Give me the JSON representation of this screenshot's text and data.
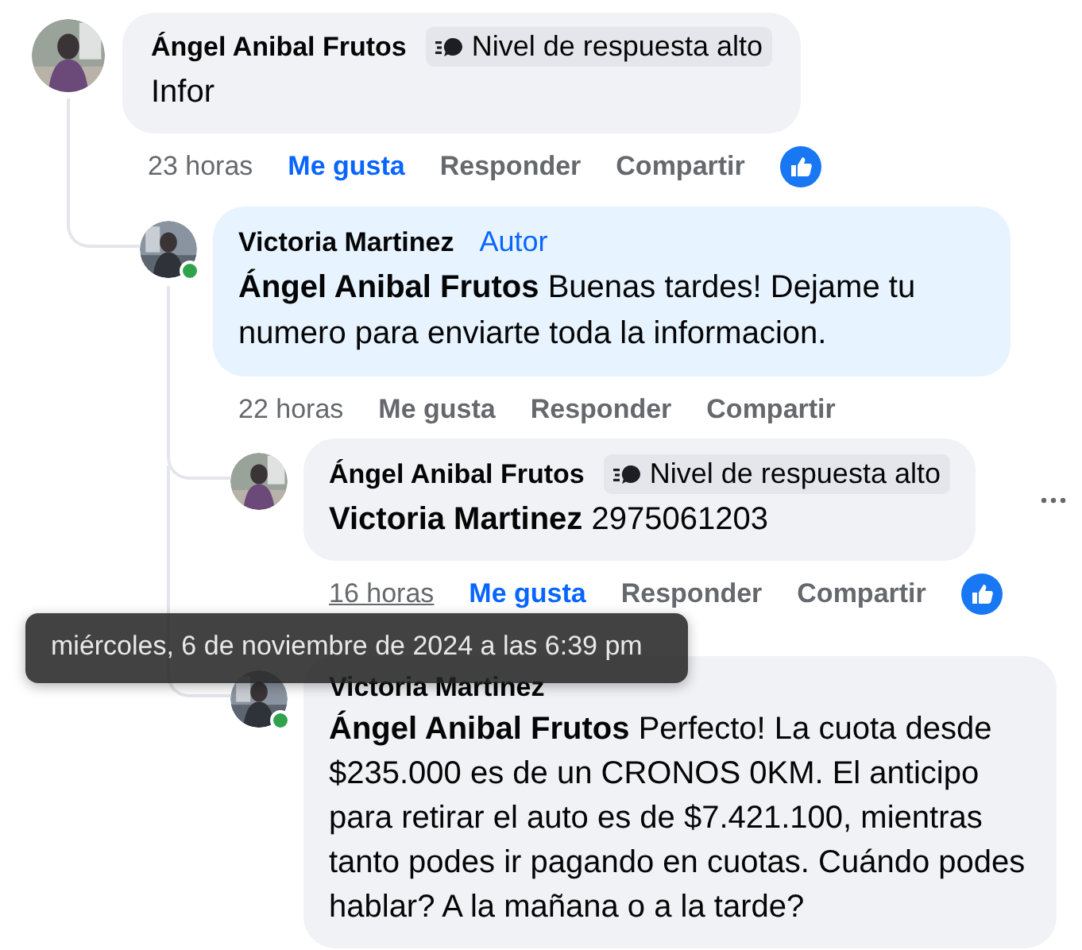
{
  "comments": [
    {
      "author": "Ángel Anibal Frutos",
      "badge": {
        "kind": "responder",
        "text": "Nivel de respuesta alto"
      },
      "text": "Infor",
      "time": "23 horas",
      "time_hovered": false,
      "like_label": "Me gusta",
      "liked": true,
      "reply_label": "Responder",
      "share_label": "Compartir",
      "like_reaction": true,
      "children": [
        {
          "author": "Victoria Martinez",
          "badge": {
            "kind": "author",
            "text": "Autor"
          },
          "mention": "Ángel Anibal Frutos",
          "text": "Buenas tardes! Dejame tu numero para enviarte toda la informacion.",
          "online": true,
          "highlighted": true,
          "time": "22 horas",
          "time_hovered": false,
          "like_label": "Me gusta",
          "liked": false,
          "reply_label": "Responder",
          "share_label": "Compartir",
          "children": [
            {
              "author": "Ángel Anibal Frutos",
              "badge": {
                "kind": "responder",
                "text": "Nivel de respuesta alto"
              },
              "mention": "Victoria Martinez",
              "text": "2975061203",
              "time": "16 horas",
              "time_hovered": true,
              "like_label": "Me gusta",
              "liked": true,
              "reply_label": "Responder",
              "share_label": "Compartir",
              "like_reaction": true,
              "menu_visible": true
            },
            {
              "author": "Victoria Martinez",
              "mention": "Ángel Anibal Frutos",
              "text": "Perfecto! La cuota desde $235.000 es de un CRONOS 0KM. El anticipo para retirar el auto es de $7.421.100, mientras tanto podes ir pagando en cuotas. Cuándo podes hablar? A la mañana o a la tarde?",
              "online": true
            }
          ]
        }
      ]
    }
  ],
  "tooltip": {
    "text": "miércoles, 6 de noviembre de 2024 a las 6:39 pm"
  }
}
